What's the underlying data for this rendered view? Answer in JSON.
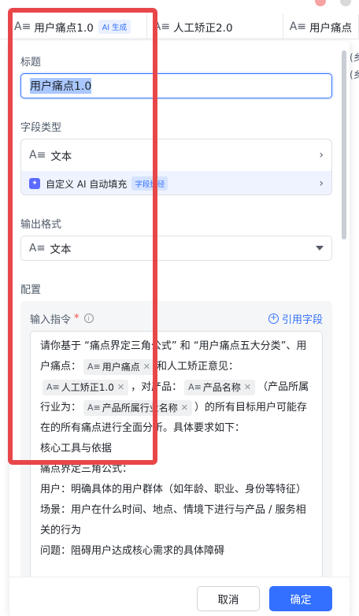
{
  "tabs": [
    {
      "icon": "A≡",
      "label": "用户痛点1.0",
      "badge": "AI 生成"
    },
    {
      "icon": "A≡",
      "label": "人工矫正2.0"
    },
    {
      "icon": "A≡",
      "label": "用户痛点"
    }
  ],
  "edge": {
    "line1": "(乡",
    "line2": "(乡"
  },
  "form": {
    "title_label": "标题",
    "title_value": "用户痛点1.0",
    "field_type_label": "字段类型",
    "field_type_value": "文本",
    "ai_fill_label": "自定义 AI 自动填充",
    "ai_fill_tag": "字段捷径",
    "output_format_label": "输出格式",
    "output_format_value": "文本",
    "config_label": "配置",
    "instruction_label": "输入指令",
    "instruction_required": "*",
    "reference_field": "引用字段"
  },
  "prompt": {
    "p1": "请你基于 “痛点界定三角公式” 和 “用户痛点五大分类”、用户痛点：",
    "chip_pain": "用户痛点",
    "p2": "和人工矫正意见：",
    "chip_correct": "人工矫正1.0",
    "p3": "，对产品：",
    "chip_product": "产品名称",
    "p4": "（产品所属行业为：",
    "chip_industry": "产品所属行业名称",
    "p5": "）的所有目标用户可能存在的所有痛点进行全面分析。具体要求如下：",
    "l1": "核心工具与依据",
    "l2": "痛点界定三角公式：",
    "l3": "用户：明确具体的用户群体（如年龄、职业、身份等特征）",
    "l4": "场景：用户在什么时间、地点、情境下进行与产品 / 服务相关的行为",
    "l5": "问题：阻碍用户达成核心需求的具体障碍"
  },
  "footer": {
    "cancel": "取消",
    "confirm": "确定"
  },
  "colors": {
    "accent": "#3370ff",
    "highlight": "#e8474a"
  }
}
